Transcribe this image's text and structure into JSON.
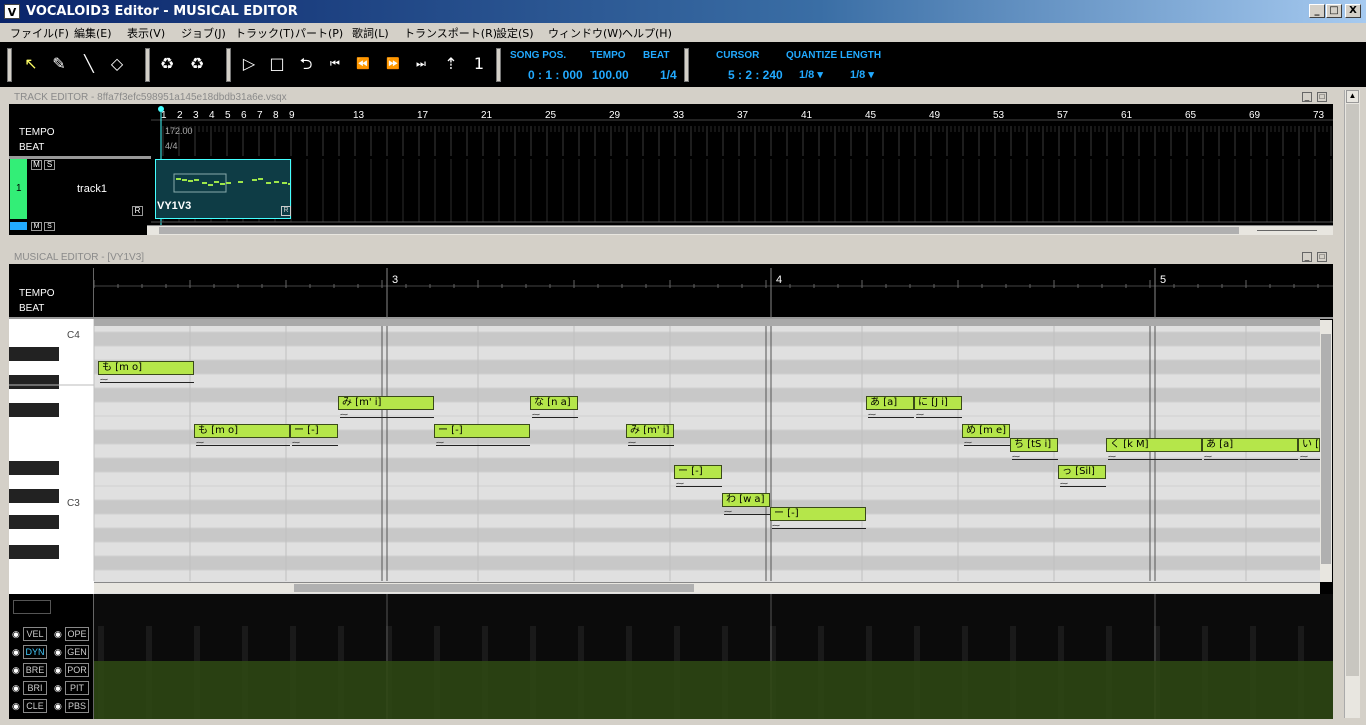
{
  "window": {
    "title": "VOCALOID3 Editor - MUSICAL EDITOR",
    "icon": "V",
    "min": "_",
    "max": "□",
    "close": "X"
  },
  "menu": [
    "ファイル(F)",
    "編集(E)",
    "表示(V)",
    "ジョブ(J)",
    "トラック(T)",
    "パート(P)",
    "歌詞(L)",
    "トランスポート(R)",
    "設定(S)",
    "ウィンドウ(W)",
    "ヘルプ(H)"
  ],
  "toolbar": {
    "song_pos_label": "SONG POS.",
    "song_pos": "0 : 1 : 000",
    "tempo_label": "TEMPO",
    "tempo": "100.00",
    "beat_label": "BEAT",
    "beat": "1/4",
    "cursor_label": "CURSOR",
    "cursor": "5 : 2 : 240",
    "quantize_label": "QUANTIZE",
    "quantize": "1/8 ▾",
    "length_label": "LENGTH",
    "length": "1/8 ▾"
  },
  "track_editor": {
    "title": "TRACK EDITOR - 8ffa7f3efc598951a145e18dbdb31a6e.vsqx",
    "tempo_label": "TEMPO",
    "beat_label": "BEAT",
    "tempo_value": "172.00",
    "beat_value": "4/4",
    "measures": [
      "1",
      "2",
      "3",
      "4",
      "5",
      "6",
      "7",
      "8",
      "9",
      "13",
      "17",
      "21",
      "25",
      "29",
      "33",
      "37",
      "41",
      "45",
      "49",
      "53",
      "57",
      "61",
      "65",
      "69",
      "73"
    ],
    "track_number": "1",
    "track_name": "track1",
    "m": "M",
    "s": "S",
    "r": "R",
    "part_name": "VY1V3"
  },
  "musical_editor": {
    "title": "MUSICAL EDITOR - [VY1V3]",
    "tempo_label": "TEMPO",
    "beat_label": "BEAT",
    "measures": [
      "3",
      "4",
      "5"
    ],
    "keys": [
      "C4",
      "C3"
    ],
    "notes": [
      {
        "lyric": "も [m o]"
      },
      {
        "lyric": "も [m o]"
      },
      {
        "lyric": "ー [-]"
      },
      {
        "lyric": "み [m' i]"
      },
      {
        "lyric": "ー [-]"
      },
      {
        "lyric": "な [n a]"
      },
      {
        "lyric": "み [m' i]"
      },
      {
        "lyric": "ー [-]"
      },
      {
        "lyric": "わ [w a]"
      },
      {
        "lyric": "ー [-]"
      },
      {
        "lyric": "あ [a]"
      },
      {
        "lyric": "に [J i]"
      },
      {
        "lyric": "め [m e]"
      },
      {
        "lyric": "ち [tS i]"
      },
      {
        "lyric": "っ [Sil]"
      },
      {
        "lyric": "く [k M]"
      },
      {
        "lyric": "あ [a]"
      },
      {
        "lyric": "い [i]"
      }
    ]
  },
  "control_track": {
    "buttons": [
      [
        "VEL",
        "OPE"
      ],
      [
        "DYN",
        "GEN"
      ],
      [
        "BRE",
        "POR"
      ],
      [
        "BRI",
        "PIT"
      ],
      [
        "CLE",
        "PBS"
      ]
    ]
  }
}
